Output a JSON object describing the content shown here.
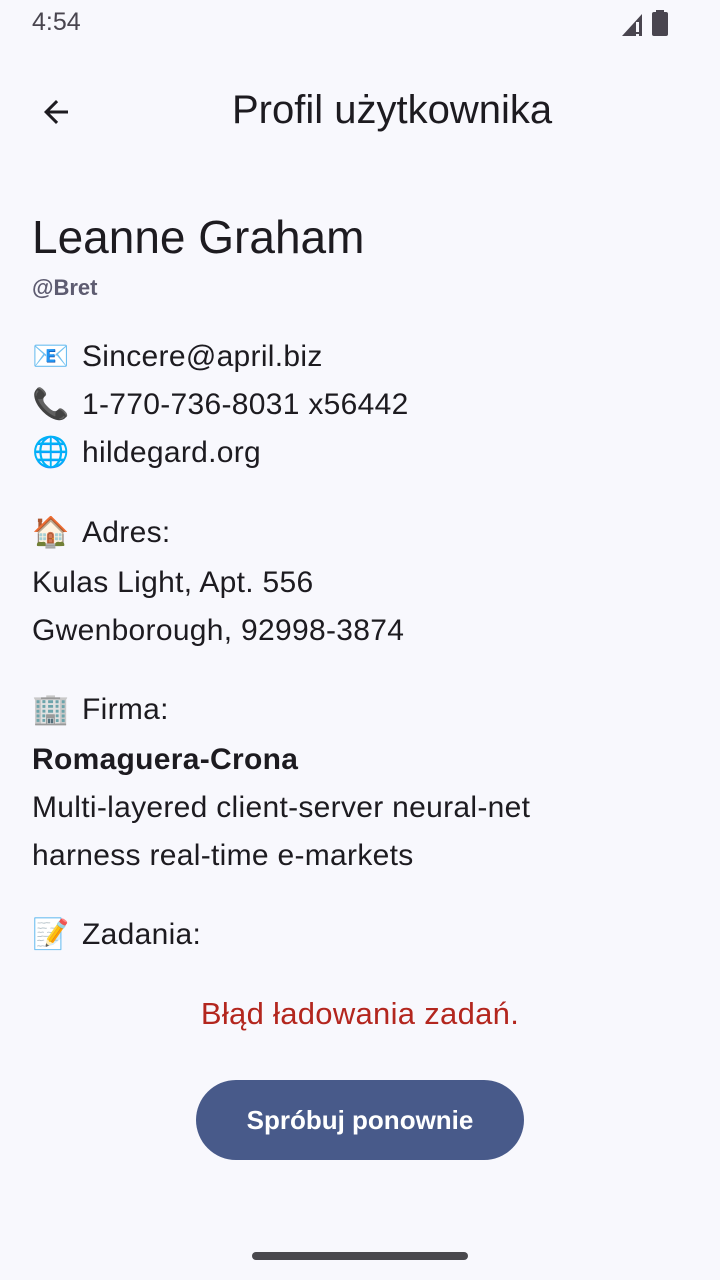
{
  "status_bar": {
    "time": "4:54"
  },
  "app_bar": {
    "title": "Profil użytkownika",
    "back_icon": "arrow-back-icon"
  },
  "user": {
    "name": "Leanne Graham",
    "username": "@Bret",
    "email_icon": "📧",
    "email": "Sincere@april.biz",
    "phone_icon": "📞",
    "phone": "1-770-736-8031 x56442",
    "website_icon": "🌐",
    "website": "hildegard.org"
  },
  "address": {
    "icon": "🏠",
    "label": "Adres:",
    "line1": "Kulas Light, Apt. 556",
    "line2": "Gwenborough, 92998-3874"
  },
  "company": {
    "icon": "🏢",
    "label": "Firma:",
    "name": "Romaguera-Crona",
    "catch_line1": "Multi-layered client-server neural-net",
    "catch_line2": "harness real-time e-markets"
  },
  "tasks": {
    "icon": "📝",
    "label": "Zadania:",
    "error": "Błąd ładowania zadań.",
    "retry_label": "Spróbuj ponownie"
  },
  "colors": {
    "background": "#f8f8fd",
    "error": "#b3261e",
    "button": "#485a8a"
  }
}
